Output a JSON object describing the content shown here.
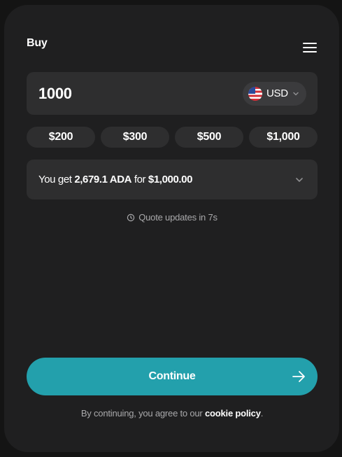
{
  "header": {
    "title": "Buy",
    "menu_icon": "hamburger-menu-icon"
  },
  "amount": {
    "value": "1000",
    "currency": "USD",
    "flag_icon": "us-flag-icon",
    "chevron_icon": "chevron-down-icon"
  },
  "quick_amounts": [
    "$200",
    "$300",
    "$500",
    "$1,000"
  ],
  "quote": {
    "prefix": "You get ",
    "receive_amount": "2,679.1 ADA",
    "middle": " for ",
    "pay_amount": "$1,000.00",
    "chevron_icon": "chevron-down-icon"
  },
  "refresh": {
    "text": "Quote updates in 7s",
    "icon": "clock-icon"
  },
  "continue": {
    "label": "Continue",
    "icon": "arrow-right-icon",
    "color": "#23a0ac"
  },
  "legal": {
    "prefix": "By continuing, you agree to our ",
    "link_text": "cookie policy",
    "suffix": "."
  },
  "colors": {
    "background": "#141414",
    "panel": "#1f1f20",
    "field": "#2e2e2f",
    "accent": "#23a0ac",
    "muted_text": "#a9a9ab"
  }
}
